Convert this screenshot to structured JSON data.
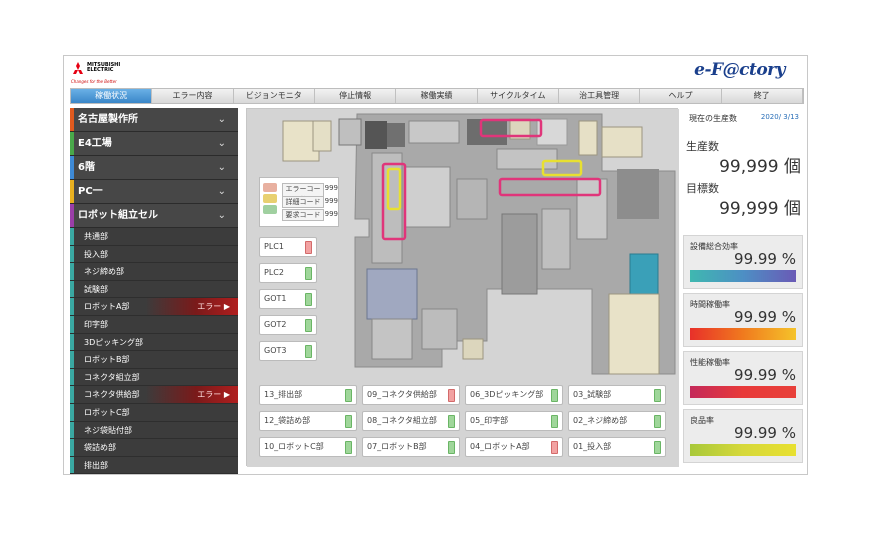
{
  "header": {
    "logo_line1": "MITSUBISHI",
    "logo_line2": "ELECTRIC",
    "logo_tagline": "Changes for the Better",
    "brand": "e-F@ctory"
  },
  "nav": {
    "tabs": [
      "稼働状況",
      "エラー内容",
      "ビジョンモニタ",
      "停止情報",
      "稼働実績",
      "サイクルタイム",
      "治工具管理",
      "ヘルプ",
      "終了"
    ],
    "active": 0
  },
  "sidebar": {
    "sections": [
      {
        "label": "名古屋製作所",
        "color": "#e05a1e"
      },
      {
        "label": "E4工場",
        "color": "#49a84a"
      },
      {
        "label": "6階",
        "color": "#3e8ad6"
      },
      {
        "label": "PC一",
        "color": "#e8b020"
      },
      {
        "label": "ロボット組立セル",
        "color": "#9a3ea8"
      }
    ],
    "items": [
      {
        "label": "共通部",
        "status": ""
      },
      {
        "label": "投入部",
        "status": ""
      },
      {
        "label": "ネジ締め部",
        "status": ""
      },
      {
        "label": "試験部",
        "status": ""
      },
      {
        "label": "ロボットA部",
        "status": "エラー"
      },
      {
        "label": "印字部",
        "status": ""
      },
      {
        "label": "3Dピッキング部",
        "status": ""
      },
      {
        "label": "ロボットB部",
        "status": ""
      },
      {
        "label": "コネクタ組立部",
        "status": ""
      },
      {
        "label": "コネクタ供給部",
        "status": "エラー"
      },
      {
        "label": "ロボットC部",
        "status": ""
      },
      {
        "label": "ネジ袋貼付部",
        "status": ""
      },
      {
        "label": "袋詰め部",
        "status": ""
      },
      {
        "label": "排出部",
        "status": ""
      }
    ]
  },
  "error_panel": {
    "rows": [
      {
        "key": "エラーコード",
        "value": "999"
      },
      {
        "key": "詳細コード",
        "value": "999"
      },
      {
        "key": "要求コード",
        "value": "999"
      }
    ]
  },
  "controllers": [
    {
      "label": "PLC1",
      "state": "error"
    },
    {
      "label": "PLC2",
      "state": "ok"
    },
    {
      "label": "GOT1",
      "state": "ok"
    },
    {
      "label": "GOT2",
      "state": "ok"
    },
    {
      "label": "GOT3",
      "state": "ok"
    }
  ],
  "cells": [
    [
      {
        "label": "13_排出部",
        "state": "ok"
      },
      {
        "label": "09_コネクタ供給部",
        "state": "error"
      },
      {
        "label": "06_3Dピッキング部",
        "state": "ok"
      },
      {
        "label": "03_試験部",
        "state": "ok"
      }
    ],
    [
      {
        "label": "12_袋詰め部",
        "state": "ok"
      },
      {
        "label": "08_コネクタ組立部",
        "state": "ok"
      },
      {
        "label": "05_印字部",
        "state": "ok"
      },
      {
        "label": "02_ネジ締め部",
        "state": "ok"
      }
    ],
    [
      {
        "label": "10_ロボットC部",
        "state": "ok"
      },
      {
        "label": "07_ロボットB部",
        "state": "ok"
      },
      {
        "label": "04_ロボットA部",
        "state": "error"
      },
      {
        "label": "01_投入部",
        "state": "ok"
      }
    ]
  ],
  "production": {
    "title": "現在の生産数",
    "date": "2020/ 3/13",
    "produced_label": "生産数",
    "produced_value": "99,999 個",
    "target_label": "目標数",
    "target_value": "99,999 個"
  },
  "metrics": [
    {
      "label": "設備総合効率",
      "value": "99.99 %",
      "gradient": "linear-gradient(90deg,#3fb8b0,#4d8fc4,#6a5ab6)"
    },
    {
      "label": "時間稼働率",
      "value": "99.99 %",
      "gradient": "linear-gradient(90deg,#e8302a,#f07a1e,#f5c32a)"
    },
    {
      "label": "性能稼働率",
      "value": "99.99 %",
      "gradient": "linear-gradient(90deg,#c42a5a,#e83a3a,#e8403a)"
    },
    {
      "label": "良品率",
      "value": "99.99 %",
      "gradient": "linear-gradient(90deg,#a8c83a,#d6d83a,#e8e030)"
    }
  ],
  "colors": {
    "ok": "#9fd69a",
    "error": "#f2a2a2",
    "highlight_error": "#e0357a",
    "highlight_warn": "#e8e030"
  }
}
